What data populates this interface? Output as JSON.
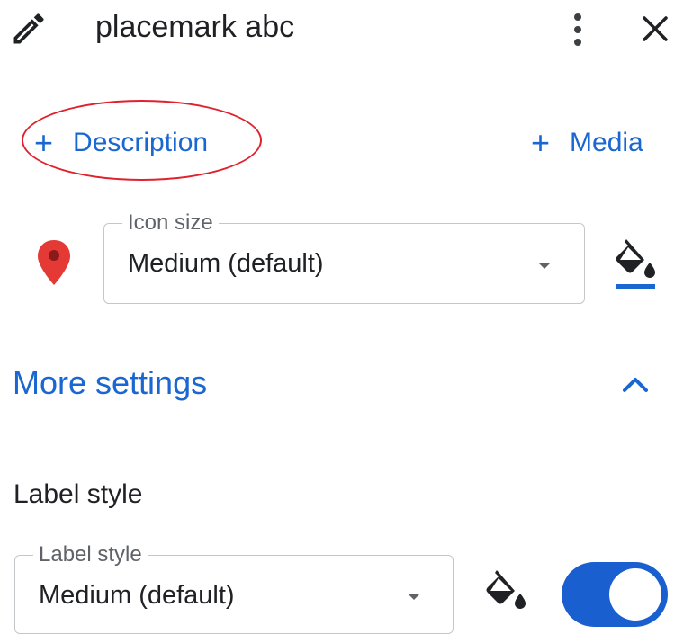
{
  "header": {
    "title": "placemark abc",
    "edit_icon": "pencil-icon",
    "menu_icon": "more-vert-icon",
    "close_icon": "close-icon"
  },
  "actions": {
    "description_label": "Description",
    "media_label": "Media",
    "plus_glyph": "+"
  },
  "icon_size": {
    "legend": "Icon size",
    "value": "Medium (default)",
    "marker_icon": "map-pin-icon",
    "marker_color": "#e53935",
    "paint_icon": "paint-bucket-icon",
    "paint_underline_color": "#1a67d2"
  },
  "more_settings": {
    "label": "More settings",
    "expanded": true
  },
  "label_style": {
    "section_title": "Label style",
    "legend": "Label style",
    "value": "Medium (default)",
    "paint_icon": "paint-bucket-icon",
    "toggle_on": true
  },
  "colors": {
    "accent": "#1a67d2",
    "annotation": "#e0212e"
  }
}
